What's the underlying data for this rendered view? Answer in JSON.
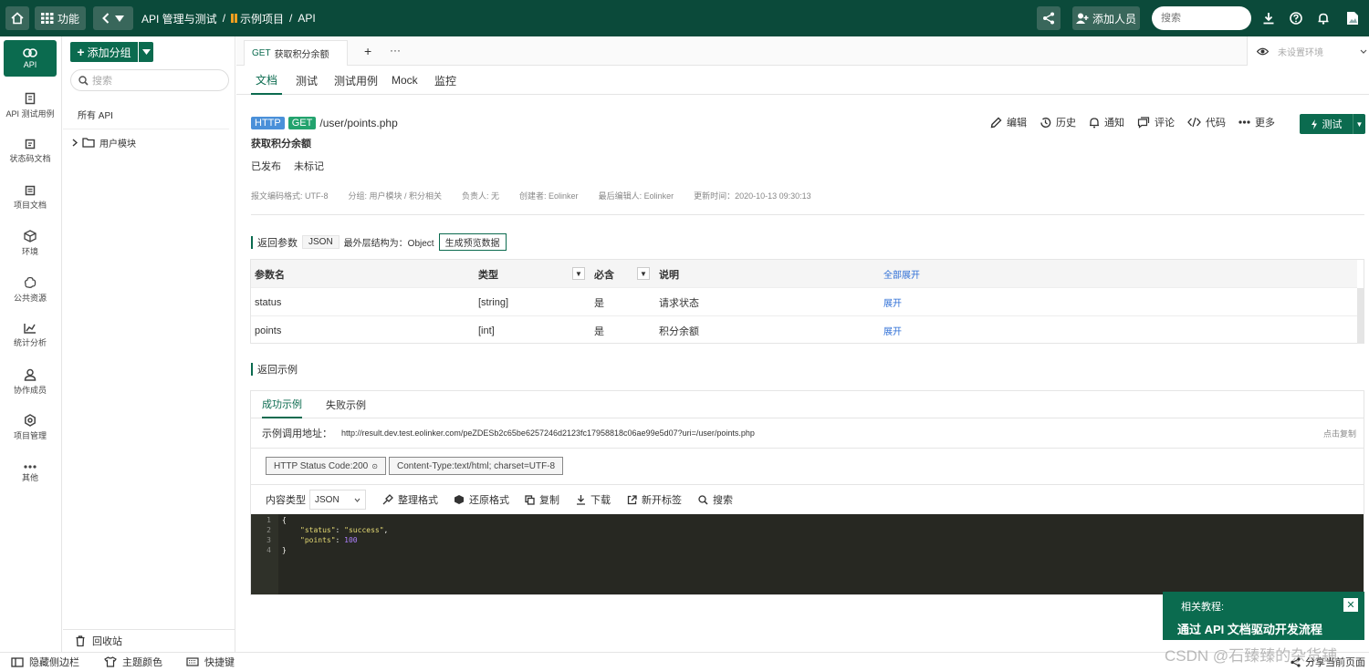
{
  "topbar": {
    "func_label": "功能",
    "crumb": [
      "API 管理与测试",
      "/",
      "示例项目",
      "/",
      "API"
    ],
    "add_member_label": "添加人员",
    "search_placeholder": "搜索"
  },
  "rail": [
    {
      "label": "API",
      "icon": "link-icon"
    },
    {
      "label": "API 测试用例",
      "icon": "test-case-icon"
    },
    {
      "label": "状态码文档",
      "icon": "status-code-icon"
    },
    {
      "label": "项目文档",
      "icon": "doc-icon"
    },
    {
      "label": "环境",
      "icon": "env-icon"
    },
    {
      "label": "公共资源",
      "icon": "resource-icon"
    },
    {
      "label": "统计分析",
      "icon": "chart-icon"
    },
    {
      "label": "协作成员",
      "icon": "members-icon"
    },
    {
      "label": "项目管理",
      "icon": "settings-icon"
    },
    {
      "label": "其他",
      "icon": "more-icon"
    }
  ],
  "nav": {
    "add_group_label": "添加分组",
    "search_placeholder": "搜索",
    "all_api": "所有 API",
    "folder": "用户模块",
    "recycle": "回收站"
  },
  "bottombar": {
    "hide_sidebar": "隐藏侧边栏",
    "theme": "主题颜色",
    "shortcuts": "快捷键",
    "share_page": "分享当前页面"
  },
  "main": {
    "tab_method": "GET",
    "tab_title": "获取积分余额",
    "env_label": "未设置环境",
    "subtabs": [
      "文档",
      "测试",
      "测试用例",
      "Mock",
      "监控"
    ],
    "protocol": "HTTP",
    "method": "GET",
    "path": "/user/points.php",
    "api_name": "获取积分余额",
    "status": [
      "已发布",
      "未标记"
    ],
    "meta": [
      "报文编码格式: UTF-8",
      "分组: 用户模块 / 积分相关",
      "负责人: 无",
      "创建者: Eolinker",
      "最后编辑人: Eolinker",
      "更新时间：2020-10-13 09:30:13"
    ],
    "actions": [
      "编辑",
      "历史",
      "通知",
      "评论",
      "代码",
      "更多"
    ],
    "test_label": "测试",
    "return_params_title": "返回参数",
    "return_format": "JSON",
    "outer_struct": "最外层结构为：Object",
    "gen_preview": "生成预览数据",
    "table_headers": [
      "参数名",
      "类型",
      "必含",
      "说明",
      "全部展开"
    ],
    "table_rows": [
      {
        "name": "status",
        "type": "[string]",
        "required": "是",
        "desc": "请求状态",
        "action": "展开"
      },
      {
        "name": "points",
        "type": "[int]",
        "required": "是",
        "desc": "积分余额",
        "action": "展开"
      }
    ],
    "return_example_title": "返回示例",
    "example_tabs": [
      "成功示例",
      "失败示例"
    ],
    "example_url_label": "示例调用地址：",
    "example_url": "http://result.dev.test.eolinker.com/peZDESb2c65be6257246d2123fc17958818c06ae99e5d07?uri=/user/points.php",
    "copy_link": "点击复制",
    "status_code_tag": "HTTP Status Code:200",
    "content_type_tag": "Content-Type:text/html; charset=UTF-8",
    "content_type_label": "内容类型",
    "content_type_value": "JSON",
    "tools": [
      "整理格式",
      "还原格式",
      "复制",
      "下载",
      "新开标签",
      "搜索"
    ],
    "code_line_numbers": [
      "1",
      "2",
      "3",
      "4"
    ],
    "code": {
      "open": "{",
      "k1": "\"status\"",
      "v1": "\"success\"",
      "k2": "\"points\"",
      "v2": "100",
      "close": "}"
    }
  },
  "tutorial": {
    "title": "相关教程:",
    "link": "通过 API 文档驱动开发流程"
  },
  "watermark": "CSDN @石臻臻的杂货铺",
  "colors": {
    "brand": "#0b4a3a",
    "accent": "#0b6b4f",
    "http_badge": "#4a90d9",
    "get_badge": "#23a36e",
    "link": "#2f6fd6"
  }
}
